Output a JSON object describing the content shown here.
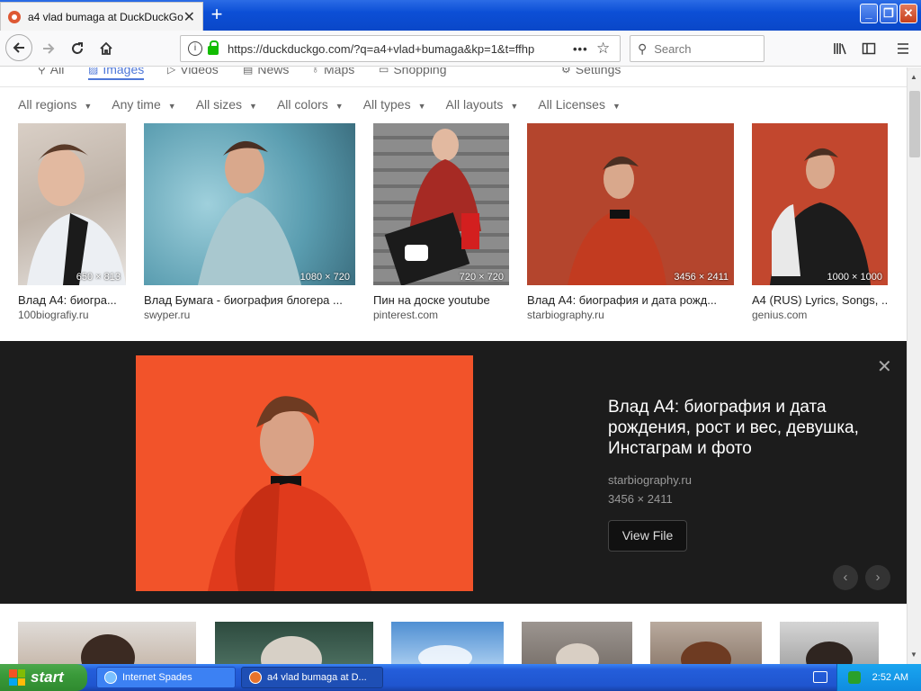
{
  "browser": {
    "tab_title": "a4 vlad bumaga at DuckDuckGo",
    "tab_close": "✕",
    "new_tab": "+",
    "url": "https://duckduckgo.com/?q=a4+vlad+bumaga&kp=1&t=ffhp",
    "search_placeholder": "Search",
    "window_buttons": {
      "minimize": "_",
      "restore": "❐",
      "close": "✕"
    }
  },
  "page_tabs": [
    {
      "label": "All",
      "icon": "search-icon"
    },
    {
      "label": "Images",
      "icon": "image-icon",
      "active": true
    },
    {
      "label": "Videos",
      "icon": "play-icon"
    },
    {
      "label": "News",
      "icon": "news-icon"
    },
    {
      "label": "Maps",
      "icon": "pin-icon"
    },
    {
      "label": "Shopping",
      "icon": "bag-icon"
    },
    {
      "label": "Settings",
      "icon": "settings-icon"
    }
  ],
  "filters": [
    "All regions",
    "Any time",
    "All sizes",
    "All colors",
    "All types",
    "All layouts",
    "All Licenses"
  ],
  "results": [
    {
      "title": "Влад А4: биогра...",
      "source": "100biografiy.ru",
      "dims": "650 × 813",
      "color": "#c9bfb4"
    },
    {
      "title": "Влад Бумага - биография блогера ...",
      "source": "swyper.ru",
      "dims": "1080 × 720",
      "color": "#6fa9b8"
    },
    {
      "title": "Пин на доске youtube",
      "source": "pinterest.com",
      "dims": "720 × 720",
      "color": "#8a8a8a"
    },
    {
      "title": "Влад А4: биография и дата рожд...",
      "source": "starbiography.ru",
      "dims": "3456 × 2411",
      "color": "#b4452d"
    },
    {
      "title": "A4 (RUS) Lyrics, Songs, ...",
      "source": "genius.com",
      "dims": "1000 × 1000",
      "color": "#c2472e"
    }
  ],
  "detail": {
    "title": "Влад А4: биография и дата рождения, рост и вес, девушка, Инстаграм и фото",
    "source": "starbiography.ru",
    "dims": "3456 × 2411",
    "view_file": "View File",
    "close": "✕",
    "prev": "‹",
    "next": "›"
  },
  "taskbar": {
    "start": "start",
    "items": [
      "Internet Spades",
      "a4 vlad bumaga at D..."
    ],
    "clock": "2:52 AM"
  }
}
